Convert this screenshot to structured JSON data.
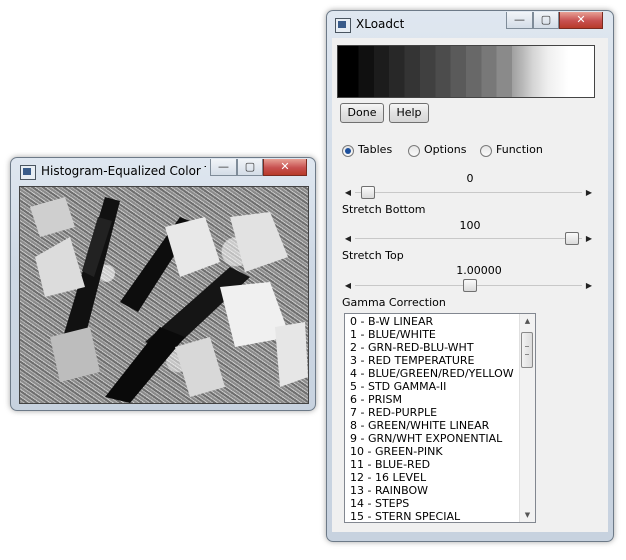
{
  "histogram_window": {
    "title": "Histogram-Equalized Color T...",
    "minimize_symbol": "—",
    "maximize_symbol": "▢",
    "close_symbol": "✕"
  },
  "xloadct_window": {
    "title": "XLoadct",
    "minimize_symbol": "—",
    "maximize_symbol": "▢",
    "close_symbol": "✕",
    "buttons": {
      "done": "Done",
      "help": "Help"
    },
    "radios": [
      {
        "label": "Tables",
        "selected": true
      },
      {
        "label": "Options",
        "selected": false
      },
      {
        "label": "Function",
        "selected": false
      }
    ],
    "sliders": [
      {
        "value_text": "0",
        "label": "Stretch Bottom",
        "level_percent": 0
      },
      {
        "value_text": "100",
        "label": "Stretch Top",
        "level_percent": 100
      },
      {
        "value_text": "1.00000",
        "label": "Gamma Correction",
        "level_percent": 50
      }
    ],
    "color_tables": [
      "0 - B-W LINEAR",
      "1 - BLUE/WHITE",
      "2 - GRN-RED-BLU-WHT",
      "3 - RED TEMPERATURE",
      "4 - BLUE/GREEN/RED/YELLOW",
      "5 - STD GAMMA-II",
      "6 - PRISM",
      "7 - RED-PURPLE",
      "8 - GREEN/WHITE LINEAR",
      "9 - GRN/WHT EXPONENTIAL",
      "10 - GREEN-PINK",
      "11 - BLUE-RED",
      "12 - 16 LEVEL",
      "13 - RAINBOW",
      "14 - STEPS",
      "15 - STERN SPECIAL"
    ]
  },
  "colors": {
    "selection": "#1c4f9c",
    "close_button": "#c75050"
  }
}
